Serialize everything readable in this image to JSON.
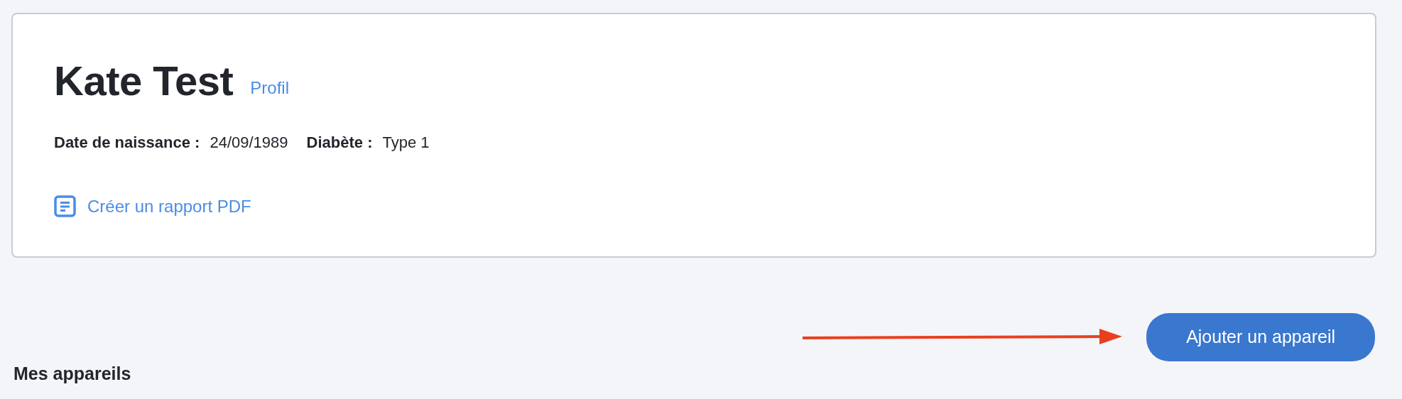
{
  "patient": {
    "name": "Kate Test",
    "profile_link": "Profil",
    "details": [
      {
        "label": "Date de naissance :",
        "value": "24/09/1989"
      },
      {
        "label": "Diabète :",
        "value": "Type 1"
      }
    ],
    "report_link": "Créer un rapport PDF"
  },
  "add_device_button": "Ajouter un appareil",
  "devices_heading": "Mes appareils"
}
